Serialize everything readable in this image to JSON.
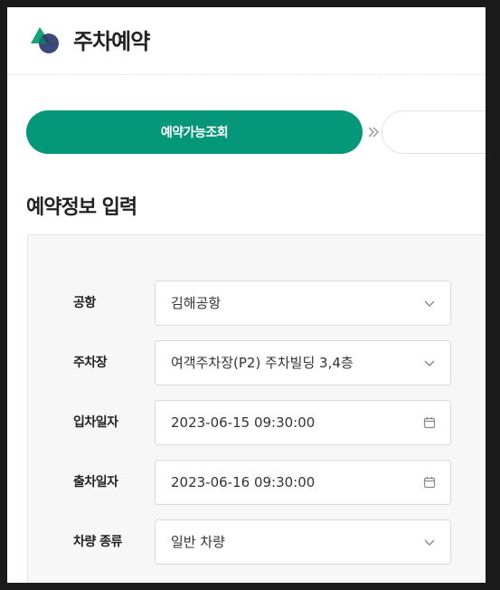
{
  "header": {
    "title": "주차예약",
    "logo_colors": {
      "green": "#1aa37a",
      "navy": "#2d3a6b"
    }
  },
  "steps": {
    "active_label": "예약가능조회",
    "active_color": "#05977a",
    "arrow_icon": "double-chevron-right-icon"
  },
  "section": {
    "title": "예약정보 입력"
  },
  "form": {
    "fields": [
      {
        "label": "공항",
        "value": "김해공항",
        "icon": "chevron-down-icon"
      },
      {
        "label": "주차장",
        "value": "여객주차장(P2) 주차빌딩 3,4층",
        "icon": "chevron-down-icon"
      },
      {
        "label": "입차일자",
        "value": "2023-06-15 09:30:00",
        "icon": "calendar-icon"
      },
      {
        "label": "출차일자",
        "value": "2023-06-16 09:30:00",
        "icon": "calendar-icon"
      },
      {
        "label": "차량 종류",
        "value": "일반 차량",
        "icon": "chevron-down-icon"
      }
    ]
  }
}
